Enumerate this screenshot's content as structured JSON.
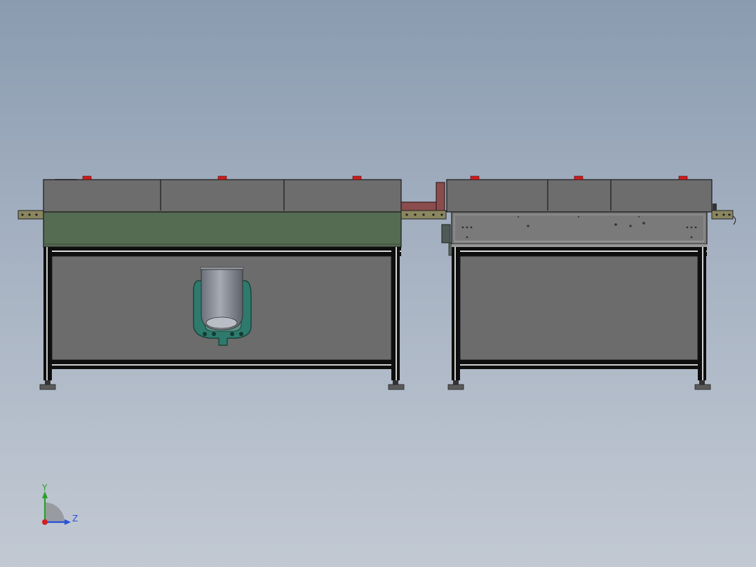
{
  "viewport": {
    "background_top": "#8a9bb0",
    "background_bottom": "#c2c9d3"
  },
  "model": {
    "machines": [
      {
        "name": "left-machine",
        "panel_color": "#556b52",
        "body_color": "#6c6c6c",
        "frame_color": "#0e0e0e"
      },
      {
        "name": "right-machine",
        "panel_color": "#7a7a7a",
        "body_color": "#6c6c6c",
        "frame_color": "#0e0e0e"
      }
    ],
    "indicator_color": "#c81e1e",
    "tank_color": "#7f838d",
    "bracket_color": "#2e7a6c",
    "rail_color": "#8a8660",
    "link_color": "#8a4c4c"
  },
  "triad": {
    "y_label": "Y",
    "z_label": "Z",
    "y_color": "#2aa02a",
    "z_color": "#2a4fd8",
    "x_color": "#d02020"
  }
}
